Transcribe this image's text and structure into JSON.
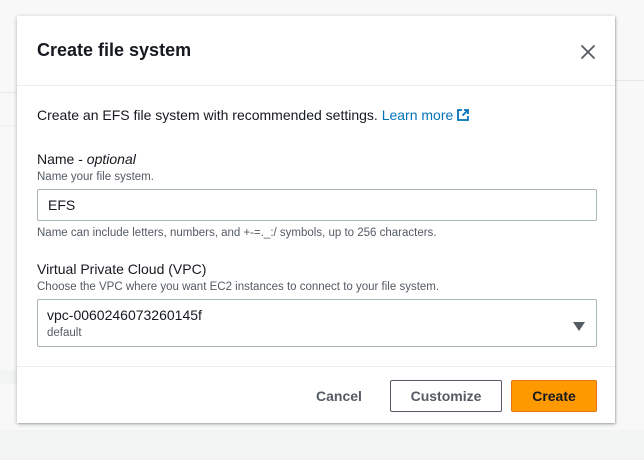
{
  "modal": {
    "title": "Create file system",
    "intro_text": "Create an EFS file system with recommended settings.",
    "learn_more_label": "Learn more"
  },
  "name_field": {
    "label": "Name - ",
    "label_optional": "optional",
    "description": "Name your file system.",
    "value": "EFS",
    "constraint": "Name can include letters, numbers, and +-=._:/ symbols, up to 256 characters."
  },
  "vpc_field": {
    "label": "Virtual Private Cloud (VPC)",
    "description": "Choose the VPC where you want EC2 instances to connect to your file system.",
    "selected_value": "vpc-0060246073260145f",
    "selected_sub": "default"
  },
  "footer": {
    "cancel_label": "Cancel",
    "customize_label": "Customize",
    "create_label": "Create"
  },
  "icons": {
    "close": "close-icon",
    "external_link": "external-link-icon",
    "caret": "caret-down-icon"
  },
  "colors": {
    "primary": "#ff9900",
    "link": "#0073bb",
    "text": "#16191f",
    "secondary_text": "#545b64"
  }
}
